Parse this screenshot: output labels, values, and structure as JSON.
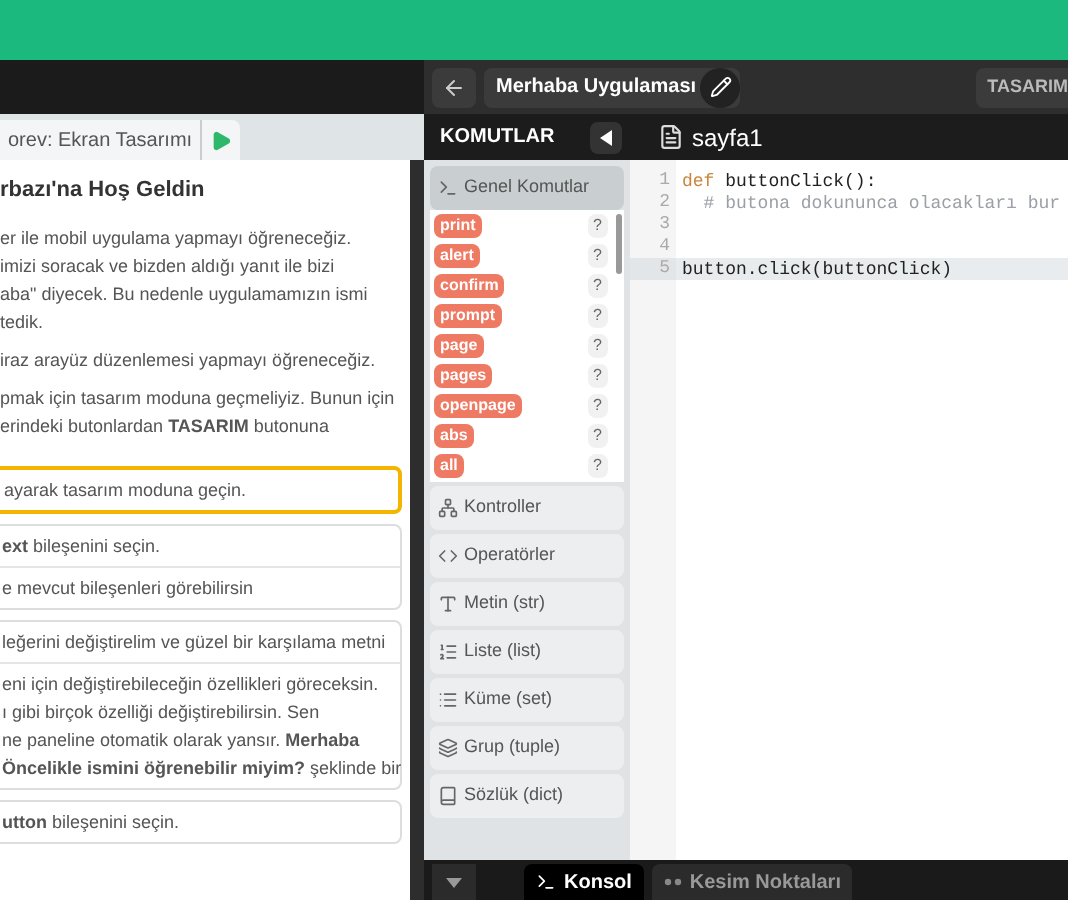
{
  "task_tab": {
    "label": "orev: Ekran Tasarımı"
  },
  "lesson": {
    "title": "rbazı'na Hoş Geldin",
    "paragraphs": [
      [
        "er ile mobil uygulama yapmayı öğreneceğiz.",
        "imizi soracak ve bizden aldığı yanıt ile bizi",
        "aba\" diyecek. Bu nedenle uygulamamızın ismi",
        "tedik."
      ],
      [
        "iraz arayüz düzenlemesi yapmayı öğreneceğiz."
      ],
      [
        "pmak için tasarım moduna geçmeliyiz. Bunun için",
        "erindeki butonlardan **TASARIM** butonuna"
      ]
    ],
    "steps": [
      {
        "active": true,
        "rows": [
          [
            "ayarak tasarım moduna geçin."
          ]
        ]
      },
      {
        "active": false,
        "rows": [
          [
            "**ext** bileşenini seçin."
          ],
          [
            "e mevcut bileşenleri görebilirsin"
          ]
        ]
      },
      {
        "active": false,
        "rows": [
          [
            "leğerini değiştirelim ve güzel bir karşılama metni"
          ],
          [
            "eni için değiştirebileceğin özellikleri göreceksin.",
            "ı gibi birçok özelliği değiştirebilirsin. Sen",
            "ne paneline otomatik olarak yansır. **Merhaba**",
            "**Öncelikle ismini öğrenebilir miyim?** şeklinde bir"
          ]
        ]
      },
      {
        "active": false,
        "rows": [
          [
            "**utton** bileşenini seçin."
          ]
        ]
      }
    ]
  },
  "app_title": "Merhaba Uygulaması",
  "design_button": "TASARIM",
  "commands_title": "KOMUTLAR",
  "file_tab": "sayfa1",
  "categories": [
    {
      "label": "Genel Komutlar",
      "kind": "terminal",
      "expanded": true,
      "commands": [
        "print",
        "alert",
        "confirm",
        "prompt",
        "page",
        "pages",
        "openpage",
        "abs",
        "all"
      ],
      "help": "?"
    },
    {
      "label": "Kontroller",
      "kind": "tree",
      "expanded": false
    },
    {
      "label": "Operatörler",
      "kind": "code",
      "expanded": false
    },
    {
      "label": "Metin (str)",
      "kind": "text",
      "expanded": false
    },
    {
      "label": "Liste (list)",
      "kind": "ordered",
      "expanded": false
    },
    {
      "label": "Küme (set)",
      "kind": "list",
      "expanded": false
    },
    {
      "label": "Grup (tuple)",
      "kind": "layers",
      "expanded": false
    },
    {
      "label": "Sözlük (dict)",
      "kind": "book",
      "expanded": false
    }
  ],
  "code": [
    {
      "number": "1",
      "active": false,
      "tokens": [
        {
          "kind": "keyword",
          "text": "def"
        },
        {
          "kind": "plain",
          "text": " buttonClick():"
        }
      ]
    },
    {
      "number": "2",
      "active": false,
      "tokens": [
        {
          "kind": "comment",
          "text": "  # butona dokununca olacakları bur"
        }
      ]
    },
    {
      "number": "3",
      "active": false
    },
    {
      "number": "4",
      "active": false
    },
    {
      "number": "5",
      "active": true,
      "tokens": [
        {
          "kind": "plain",
          "text": "button.click(buttonClick)"
        }
      ]
    }
  ],
  "bottom_tabs": [
    {
      "label": "Konsol",
      "kind": "console",
      "selected": true
    },
    {
      "label": "Kesim Noktaları",
      "kind": "dots",
      "selected": false
    }
  ]
}
